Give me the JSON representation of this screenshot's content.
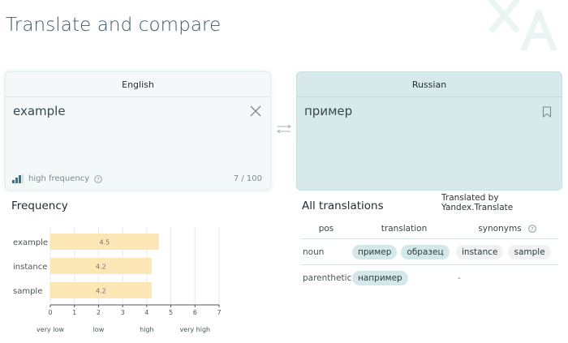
{
  "page": {
    "title": "Translate and compare"
  },
  "source": {
    "language": "English",
    "text": "example",
    "frequency_label": "high frequency",
    "char_count": "7 / 100"
  },
  "target": {
    "language": "Russian",
    "text": "пример"
  },
  "credit": "Translated by Yandex.Translate",
  "frequency_section": {
    "title": "Frequency"
  },
  "translations_section": {
    "title": "All translations",
    "headers": {
      "pos": "pos",
      "translation": "translation",
      "synonyms": "synonyms"
    },
    "rows": [
      {
        "pos": "noun",
        "translations": [
          "пример",
          "образец"
        ],
        "synonyms": [
          "instance",
          "sample"
        ]
      },
      {
        "pos": "parenthetic",
        "translations": [
          "например"
        ],
        "synonyms": [
          "-"
        ]
      }
    ]
  },
  "colors": {
    "accent": "#3a8fa3",
    "bar": "#fde6b5",
    "target_panel": "#d7e9ea",
    "chip": "#d5e8e9"
  },
  "chart_data": {
    "type": "bar",
    "orientation": "horizontal",
    "categories": [
      "example",
      "instance",
      "sample"
    ],
    "values": [
      4.5,
      4.2,
      4.2
    ],
    "data_labels": [
      "4.5",
      "4.2",
      "4.2"
    ],
    "xlim": [
      0,
      7
    ],
    "xticks": [
      "0",
      "1",
      "2",
      "3",
      "4",
      "5",
      "6",
      "7"
    ],
    "band_labels": [
      "very low",
      "low",
      "high",
      "very high"
    ],
    "grid": true
  }
}
